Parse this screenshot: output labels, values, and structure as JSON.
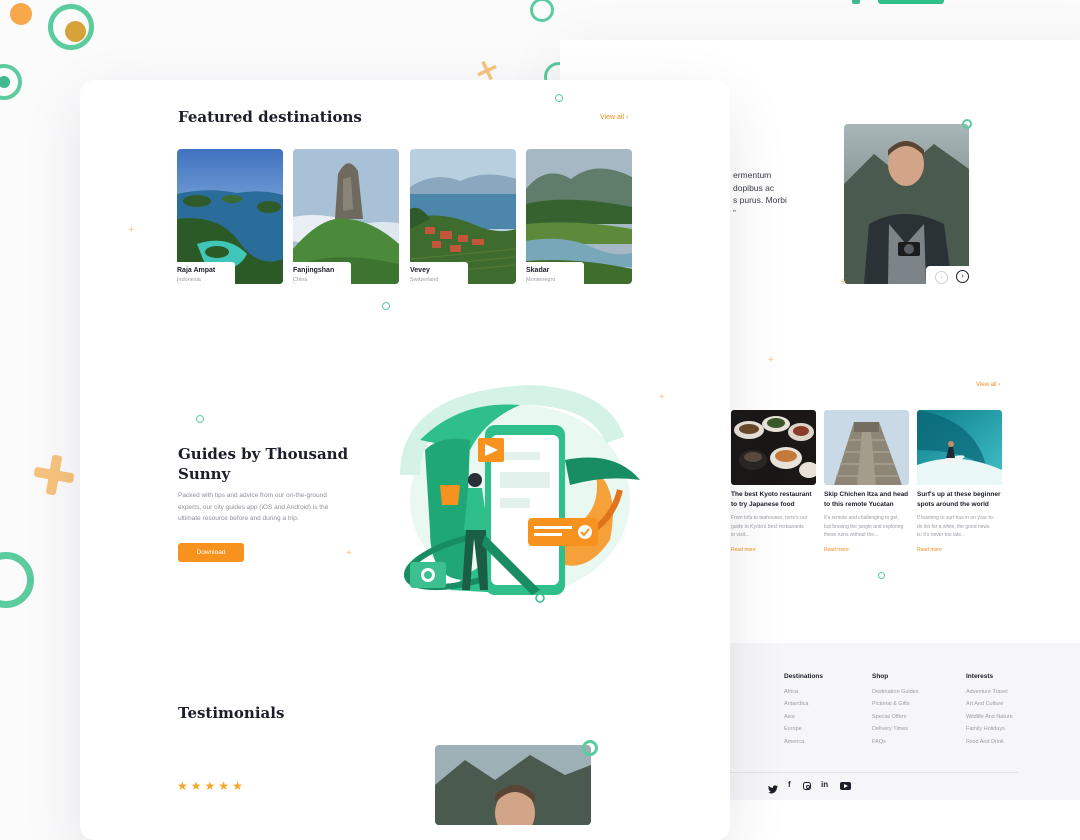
{
  "featured": {
    "title": "Featured destinations",
    "view_all": "View all ›",
    "destinations": [
      {
        "name": "Raja Ampat",
        "country": "Indonesia"
      },
      {
        "name": "Fanjingshan",
        "country": "China"
      },
      {
        "name": "Vevey",
        "country": "Switzerland"
      },
      {
        "name": "Skadar",
        "country": "Montenegro"
      }
    ]
  },
  "guides": {
    "title_line1": "Guides by Thousand",
    "title_line2": "Sunny",
    "description_lines": [
      "Packed with tips and advice from our on-the-ground",
      "experts, our city guides app (iOS and Android) is the",
      "ultimate resource before and during a trip."
    ],
    "download_label": "Download"
  },
  "testimonials": {
    "title": "Testimonials",
    "stars": [
      "★",
      "★",
      "★",
      "★",
      "★"
    ]
  },
  "back_testimonial": {
    "quote_lines": [
      "ermentum",
      "dopibus ac",
      "s purus. Morbi",
      "”"
    ]
  },
  "blog": {
    "view_all": "View all ›",
    "posts": [
      {
        "title_lines": [
          "The best Kyoto restaurant",
          "to try Japanese food"
        ],
        "excerpt_lines": [
          "From tofu to teahouses, here's our",
          "guide to Kyoto's best restaurants",
          "to visit..."
        ],
        "read_more": "Read more"
      },
      {
        "title_lines": [
          "Skip Chichen Itza and head",
          "to this remote Yucatan"
        ],
        "excerpt_lines": [
          "It's remote and challenging to get,",
          "but braving the jungle and exploring",
          "these ruins without the..."
        ],
        "read_more": "Read more"
      },
      {
        "title_lines": [
          "Surf's up at these beginner",
          "spots around the world"
        ],
        "excerpt_lines": [
          "If learning to surf has in on your to-",
          "do list for a while, the good news",
          "is: it's never too late..."
        ],
        "read_more": "Read more"
      }
    ]
  },
  "footer": {
    "columns": [
      {
        "heading": "Destinations",
        "links": [
          "Africa",
          "Antarctica",
          "Asia",
          "Europe",
          "America"
        ]
      },
      {
        "heading": "Shop",
        "links": [
          "Destination Guides",
          "Pictorial & Gifts",
          "Special Offers",
          "Delivery Times",
          "FAQs"
        ]
      },
      {
        "heading": "Interests",
        "links": [
          "Adventure Travel",
          "Art And Culture",
          "Wildlife And Nature",
          "Family Holidays",
          "Food And Drink"
        ]
      }
    ],
    "social_icons": [
      "twitter-icon",
      "facebook-icon",
      "instagram-icon",
      "linkedin-icon",
      "youtube-icon"
    ]
  },
  "colors": {
    "accent": "#f7921e",
    "brand_green": "#2fbf8a",
    "dark": "#1b1e29"
  }
}
